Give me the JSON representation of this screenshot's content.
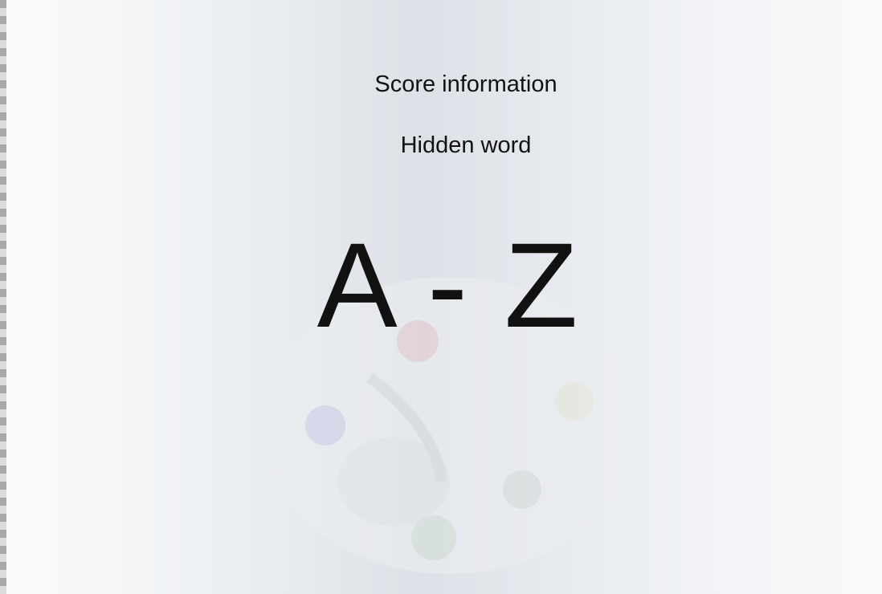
{
  "score_label": "Score information",
  "hidden_word_label": "Hidden word",
  "letter_range": "A - Z",
  "background_image": "palette-icon",
  "colors": {
    "text": "#111111",
    "background": "#e6e9ee"
  }
}
